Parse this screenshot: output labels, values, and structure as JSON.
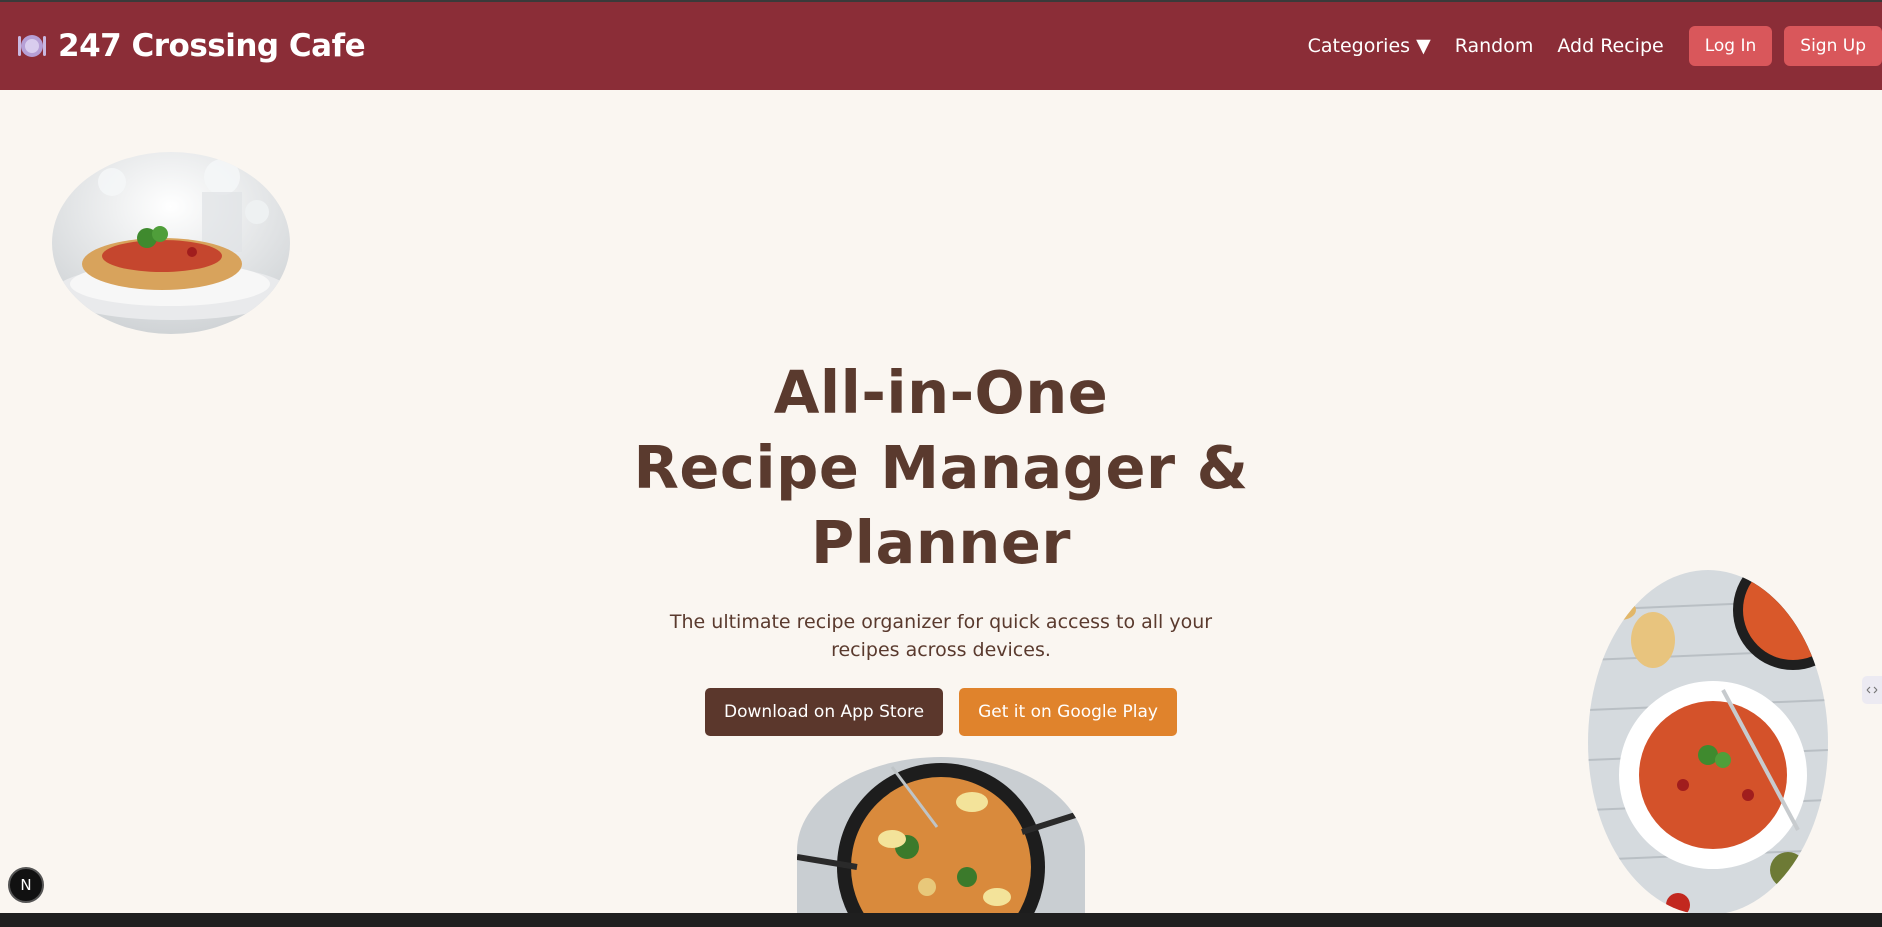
{
  "brand": {
    "name": "247 Crossing Cafe",
    "icon": "plate-cutlery-icon"
  },
  "nav": {
    "categories": "Categories ▼",
    "random": "Random",
    "add_recipe": "Add Recipe",
    "login": "Log In",
    "signup": "Sign Up"
  },
  "hero": {
    "title_line1": "All-in-One",
    "title_line2": "Recipe Manager &",
    "title_line3": "Planner",
    "subtitle": "The ultimate recipe organizer for quick access to all your recipes across devices.",
    "cta_app_store": "Download on App Store",
    "cta_google_play": "Get it on Google Play"
  },
  "images": {
    "pasta": "spaghetti-plate-image",
    "paella": "paella-pan-image",
    "fusilli": "fusilli-plate-image"
  },
  "badge": {
    "letter": "N"
  },
  "colors": {
    "navbar": "#8b2d37",
    "nav_button": "#d9575b",
    "background": "#faf6f1",
    "heading": "#5a3a2e",
    "cta_app_store": "#5b372c",
    "cta_google_play": "#e0832c"
  }
}
